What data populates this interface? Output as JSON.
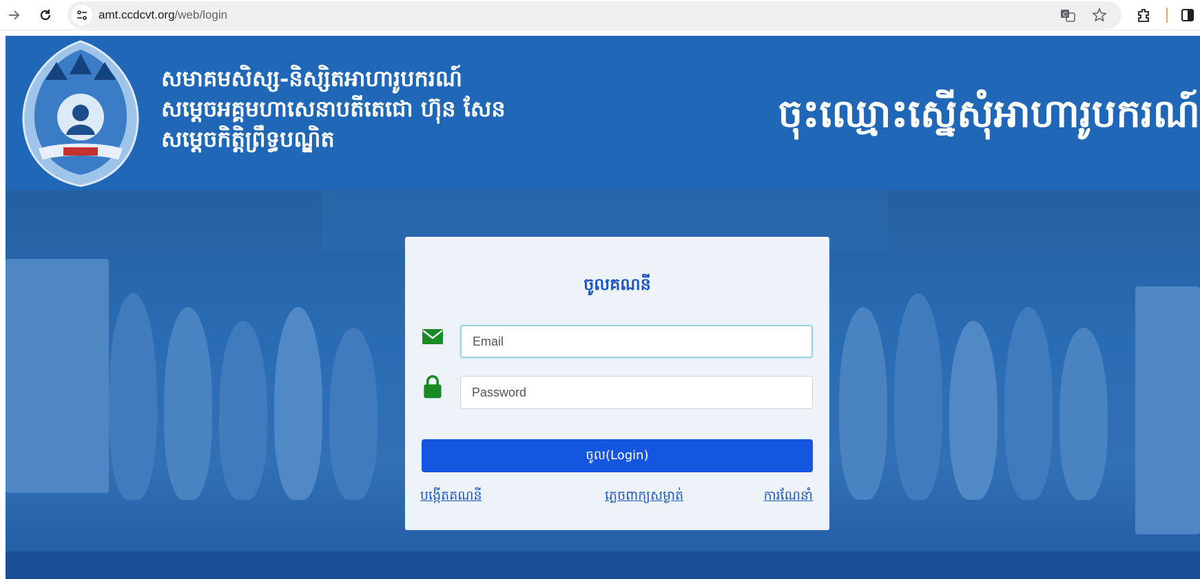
{
  "browser": {
    "url_domain": "amt.ccdcvt.org",
    "url_path": "/web/login",
    "icons": [
      "forward-icon",
      "reload-icon",
      "site-info-icon",
      "translate-icon",
      "bookmark-star-icon",
      "extensions-icon",
      "side-panel-icon"
    ]
  },
  "header": {
    "org_name_lines": [
      "សមាគមសិស្ស-និស្សិតអាហារូបករណ៍",
      "សម្តេចអគ្គមហាសេនាបតីតេជោ ហ៊ុន សែន",
      "សម្តេចកិត្តិព្រឹទ្ធបណ្ឌិត"
    ],
    "page_heading": "ចុះឈ្មោះស្នើសុំអាហារូបករណ៍",
    "colors": {
      "header_bg": "#2167b8",
      "text": "#ffffff"
    }
  },
  "login": {
    "title": "ចូលគណនី",
    "email_placeholder": "Email",
    "password_placeholder": "Password",
    "submit_label": "ចូល(Login)",
    "links": {
      "create_account": "បង្កើតគណនី",
      "forgot_password": "ភ្លេចពាក្យសម្ងាត់",
      "guide": "ការណែនាំ"
    },
    "colors": {
      "card_bg": "#eef3f9",
      "button_bg": "#1556e0",
      "link": "#1d56c2",
      "icon_green": "#1a8a25"
    }
  }
}
